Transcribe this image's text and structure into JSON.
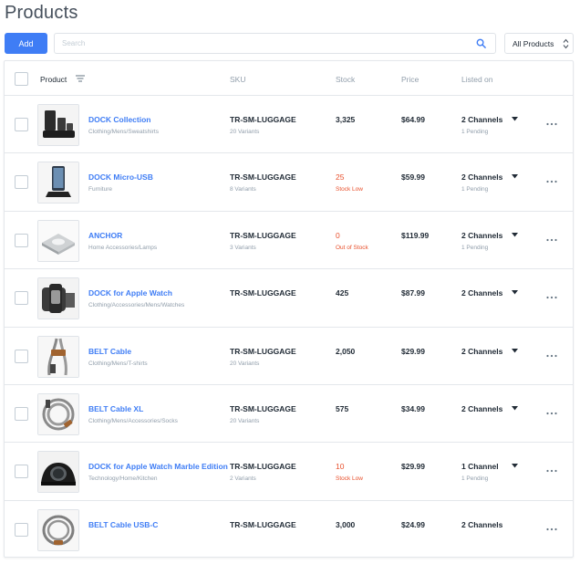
{
  "page": {
    "title": "Products"
  },
  "toolbar": {
    "add_label": "Add",
    "search_placeholder": "Search",
    "filter_value": "All Products"
  },
  "table": {
    "headers": {
      "product": "Product",
      "sku": "SKU",
      "stock": "Stock",
      "price": "Price",
      "listed_on": "Listed on"
    },
    "rows": [
      {
        "name": "DOCK Collection",
        "category": "Clothing/Mens/Sweatshirts",
        "sku": "TR-SM-LUGGAGE",
        "variants": "20 Variants",
        "stock": "3,325",
        "stock_status": "",
        "price": "$64.99",
        "channels": "2 Channels",
        "pending": "1 Pending",
        "has_dropdown": true,
        "image_icon": "dock-collection-image"
      },
      {
        "name": "DOCK Micro-USB",
        "category": "Furniture",
        "sku": "TR-SM-LUGGAGE",
        "variants": "8 Variants",
        "stock": "25",
        "stock_status": "Stock Low",
        "price": "$59.99",
        "channels": "2 Channels",
        "pending": "1 Pending",
        "has_dropdown": true,
        "image_icon": "dock-micro-usb-image"
      },
      {
        "name": "ANCHOR",
        "category": "Home Accessories/Lamps",
        "sku": "TR-SM-LUGGAGE",
        "variants": "3 Variants",
        "stock": "0",
        "stock_status": "Out of Stock",
        "price": "$119.99",
        "channels": "2 Channels",
        "pending": "1 Pending",
        "has_dropdown": true,
        "image_icon": "anchor-image"
      },
      {
        "name": "DOCK for Apple Watch",
        "category": "Clothing/Accessories/Mens/Watches",
        "sku": "TR-SM-LUGGAGE",
        "variants": "",
        "stock": "425",
        "stock_status": "",
        "price": "$87.99",
        "channels": "2 Channels",
        "pending": "",
        "has_dropdown": true,
        "image_icon": "apple-watch-dock-image"
      },
      {
        "name": "BELT Cable",
        "category": "Clothing/Mens/T-shirts",
        "sku": "TR-SM-LUGGAGE",
        "variants": "20 Variants",
        "stock": "2,050",
        "stock_status": "",
        "price": "$29.99",
        "channels": "2 Channels",
        "pending": "",
        "has_dropdown": true,
        "image_icon": "belt-cable-image"
      },
      {
        "name": "BELT Cable XL",
        "category": "Clothing/Mens/Accessories/Socks",
        "sku": "TR-SM-LUGGAGE",
        "variants": "20 Variants",
        "stock": "575",
        "stock_status": "",
        "price": "$34.99",
        "channels": "2 Channels",
        "pending": "",
        "has_dropdown": true,
        "image_icon": "belt-cable-xl-image"
      },
      {
        "name": "DOCK for Apple Watch Marble Edition",
        "category": "Technology/Home/Kitchen",
        "sku": "TR-SM-LUGGAGE",
        "variants": "2 Variants",
        "stock": "10",
        "stock_status": "Stock Low",
        "price": "$29.99",
        "channels": "1 Channel",
        "pending": "1 Pending",
        "has_dropdown": true,
        "image_icon": "marble-dock-image"
      },
      {
        "name": "BELT Cable USB-C",
        "category": "",
        "sku": "TR-SM-LUGGAGE",
        "variants": "",
        "stock": "3,000",
        "stock_status": "",
        "price": "$24.99",
        "channels": "2 Channels",
        "pending": "",
        "has_dropdown": false,
        "image_icon": "belt-cable-usbc-image"
      }
    ]
  },
  "colors": {
    "accent": "#3f7df5",
    "warning": "#e8502c",
    "muted": "#919eab",
    "border": "#e4e7eb"
  }
}
